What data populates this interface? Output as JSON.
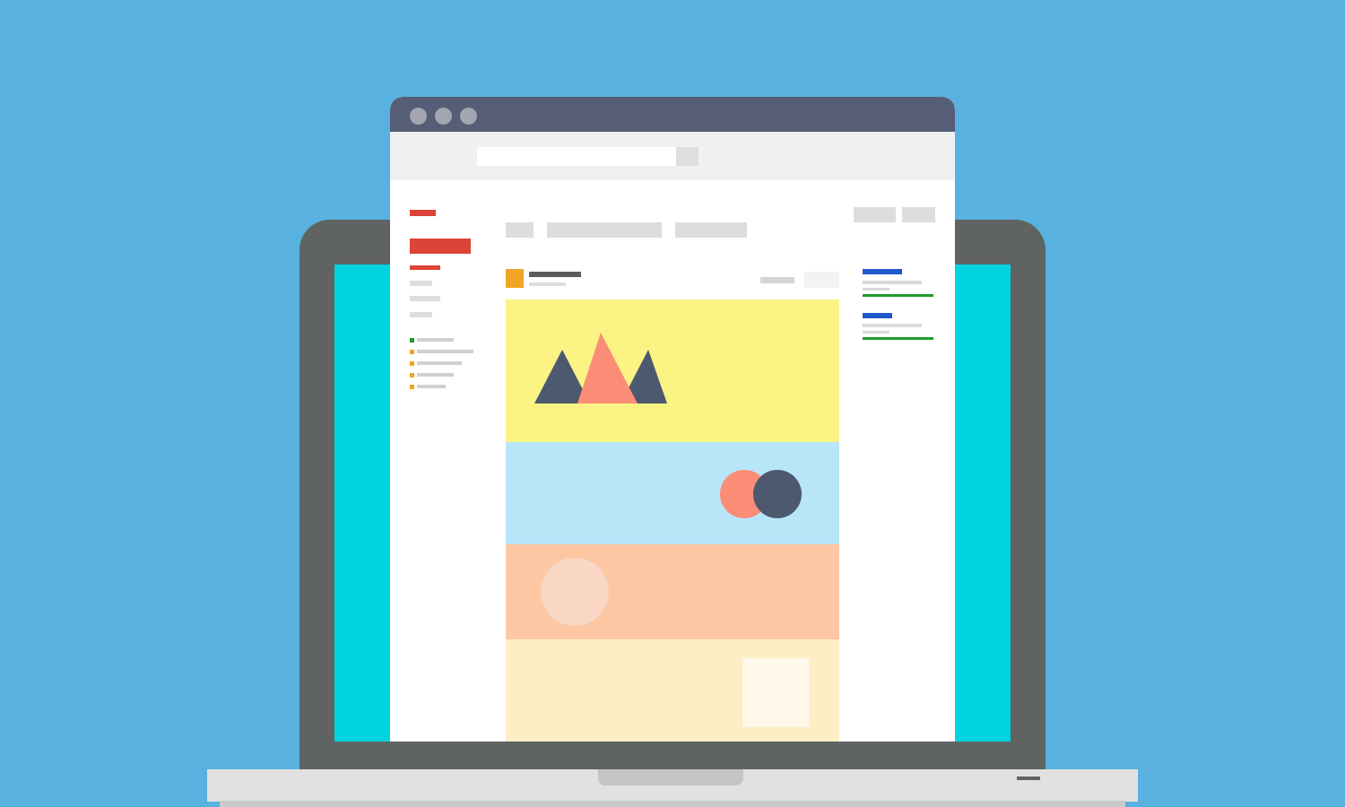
{
  "colors": {
    "background": "#58b1de",
    "laptop_frame": "#5f6361",
    "screen": "#00d4e0",
    "titlebar": "#555e76",
    "accent_red": "#dd4438",
    "accent_blue": "#2057cb",
    "accent_green": "#1f9b2b",
    "avatar_orange": "#f0a524",
    "band_yellow": "#fbf384",
    "band_blue": "#b9e5f9",
    "band_peach": "#fdc7a3",
    "band_cream": "#fdeec5",
    "shape_navy": "#4d596f",
    "shape_salmon": "#fb8d77"
  },
  "icons": {
    "window_controls": [
      "close-dot-icon",
      "minimize-dot-icon",
      "maximize-dot-icon"
    ],
    "illustration": [
      "mountains-icon",
      "circles-icon"
    ]
  },
  "browser": {
    "address_bar": {
      "value": "",
      "placeholder": ""
    }
  }
}
